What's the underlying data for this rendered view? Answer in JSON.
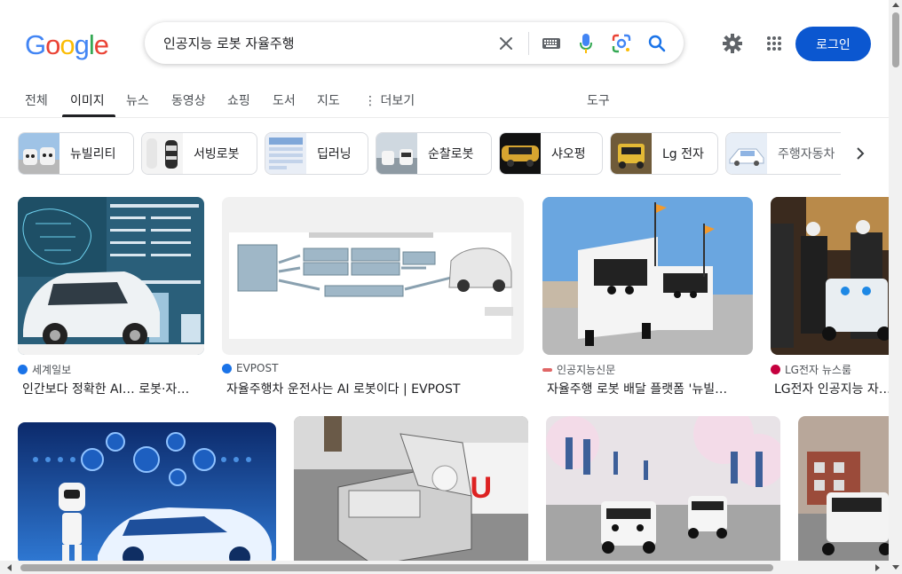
{
  "logo": {
    "text": "Google",
    "letters": [
      {
        "ch": "G",
        "color": "#4285F4"
      },
      {
        "ch": "o",
        "color": "#EA4335"
      },
      {
        "ch": "o",
        "color": "#FBBC05"
      },
      {
        "ch": "g",
        "color": "#4285F4"
      },
      {
        "ch": "l",
        "color": "#34A853"
      },
      {
        "ch": "e",
        "color": "#EA4335"
      }
    ]
  },
  "search": {
    "query": "인공지능 로봇 자율주행",
    "icons": [
      "close-icon",
      "keyboard-icon",
      "mic-icon",
      "lens-icon",
      "search-icon"
    ]
  },
  "header": {
    "login_label": "로그인",
    "icons": [
      "gear-icon",
      "apps-icon"
    ]
  },
  "tabs": [
    {
      "label": "전체",
      "active": false
    },
    {
      "label": "이미지",
      "active": true
    },
    {
      "label": "뉴스",
      "active": false
    },
    {
      "label": "동영상",
      "active": false
    },
    {
      "label": "쇼핑",
      "active": false
    },
    {
      "label": "도서",
      "active": false
    },
    {
      "label": "지도",
      "active": false
    },
    {
      "label": "더보기",
      "active": false
    }
  ],
  "tools_label": "도구",
  "chips": [
    {
      "label": "뉴빌리티"
    },
    {
      "label": "서빙로봇"
    },
    {
      "label": "딥러닝"
    },
    {
      "label": "순찰로봇"
    },
    {
      "label": "샤오펑"
    },
    {
      "label": "Lg 전자"
    },
    {
      "label": "주행자동차"
    }
  ],
  "results": [
    {
      "source": "세계일보",
      "title": "인간보다 정확한 AI… 로봇·자…",
      "fav": "#1a73e8"
    },
    {
      "source": "EVPOST",
      "title": "자율주행차 운전사는 AI 로봇이다 | EVPOST",
      "fav": "#1a73e8"
    },
    {
      "source": "인공지능신문",
      "title": "자율주행 로봇 배달 플랫폼 '뉴빌…",
      "fav": "#e06666"
    },
    {
      "source": "LG전자 뉴스룸",
      "title": "LG전자 인공지능 자…",
      "fav": "#c5003e"
    }
  ],
  "colors": {
    "accent": "#0b57d0",
    "text": "#202124",
    "muted": "#4d5156"
  }
}
